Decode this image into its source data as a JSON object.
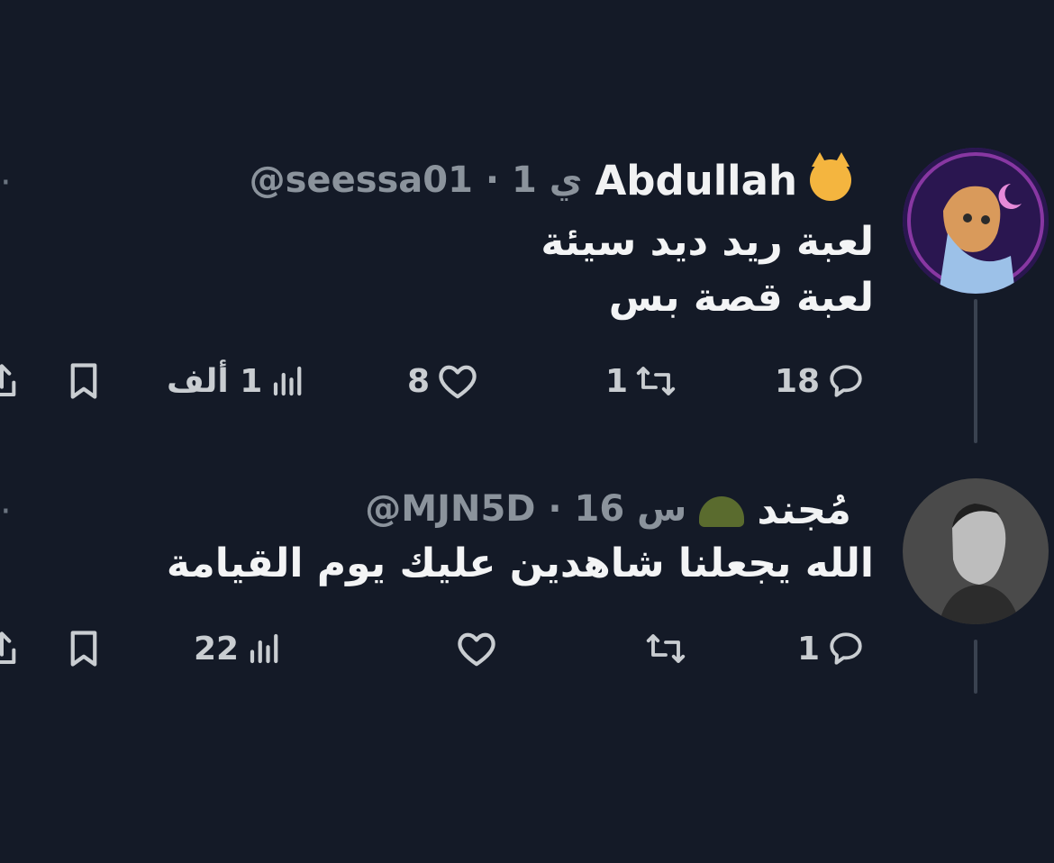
{
  "tweets": [
    {
      "display_name": "Abdullah",
      "handle_line": "@seessa01 · 1 ي",
      "body_lines": [
        "لعبة ريد ديد سيئة",
        "لعبة قصة بس"
      ],
      "avatar_icon": "anime-avatar-icon",
      "name_emoji": "cat-face-icon",
      "replies": "18",
      "retweets": "1",
      "likes": "8",
      "views": "1 ألف"
    },
    {
      "display_name": "مُجند",
      "handle_line": "@MJN5D · 16 س",
      "body_lines": [
        "الله يجعلنا شاهدين عليك يوم القيامة"
      ],
      "avatar_icon": "portrait-avatar-icon",
      "name_emoji": "military-helmet-icon",
      "replies": "1",
      "retweets": "",
      "likes": "",
      "views": "22"
    }
  ],
  "colors": {
    "background": "#141a27",
    "text": "#e7e9ea",
    "muted": "#8b939c"
  }
}
